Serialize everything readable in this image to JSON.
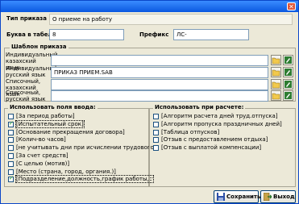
{
  "header": {
    "type_label": "Тип приказа",
    "type_value": "О приеме на работу",
    "letter_label": "Буква в табеле",
    "letter_value": "8",
    "prefix_label": "Префикс",
    "prefix_value": "ЛС-"
  },
  "template": {
    "title": "Шаблон приказа",
    "rows": [
      {
        "label": "Индивидуальный, казахский язык",
        "value": ""
      },
      {
        "label": "Индивидуальный, русский язык",
        "value": "ПРИКАЗ ПРИЕМ.SAB"
      },
      {
        "label": "Списочный, казахский язык",
        "value": ""
      },
      {
        "label": "Списочный, русский язык",
        "value": ""
      }
    ]
  },
  "input_fields": {
    "title": "Использовать поля ввода:",
    "items": [
      {
        "label": "[За период работы]",
        "checked": false
      },
      {
        "label": "[Испытательный срок]",
        "checked": true
      },
      {
        "label": "[Основание прекращения договора]",
        "checked": false
      },
      {
        "label": "[Колич-во часов]",
        "checked": false
      },
      {
        "label": "[не учитывать дни при исчислении трудового стажа д",
        "checked": false
      },
      {
        "label": "[За счет средств]",
        "checked": false
      },
      {
        "label": "[С целью (мотив)]",
        "checked": false
      },
      {
        "label": "[Место (страна, город, органия.)]",
        "checked": false
      },
      {
        "label": "[Подразделение,должность,график работы,ставка]",
        "checked": true
      }
    ]
  },
  "calc": {
    "title": "Использовать при расчете:",
    "items": [
      {
        "label": "[Алгоритм расчета дней труд.отпуска]",
        "checked": false
      },
      {
        "label": "[Алгоритм пропуска праздничных дней]",
        "checked": false
      },
      {
        "label": "[Таблица отпусков]",
        "checked": false
      },
      {
        "label": "[Отзыв с предоставлением отдыха]",
        "checked": false
      },
      {
        "label": "[Отзыв с выплатой компенсации]",
        "checked": false
      }
    ]
  },
  "buttons": {
    "save": "Сохранить",
    "exit": "Выход"
  }
}
